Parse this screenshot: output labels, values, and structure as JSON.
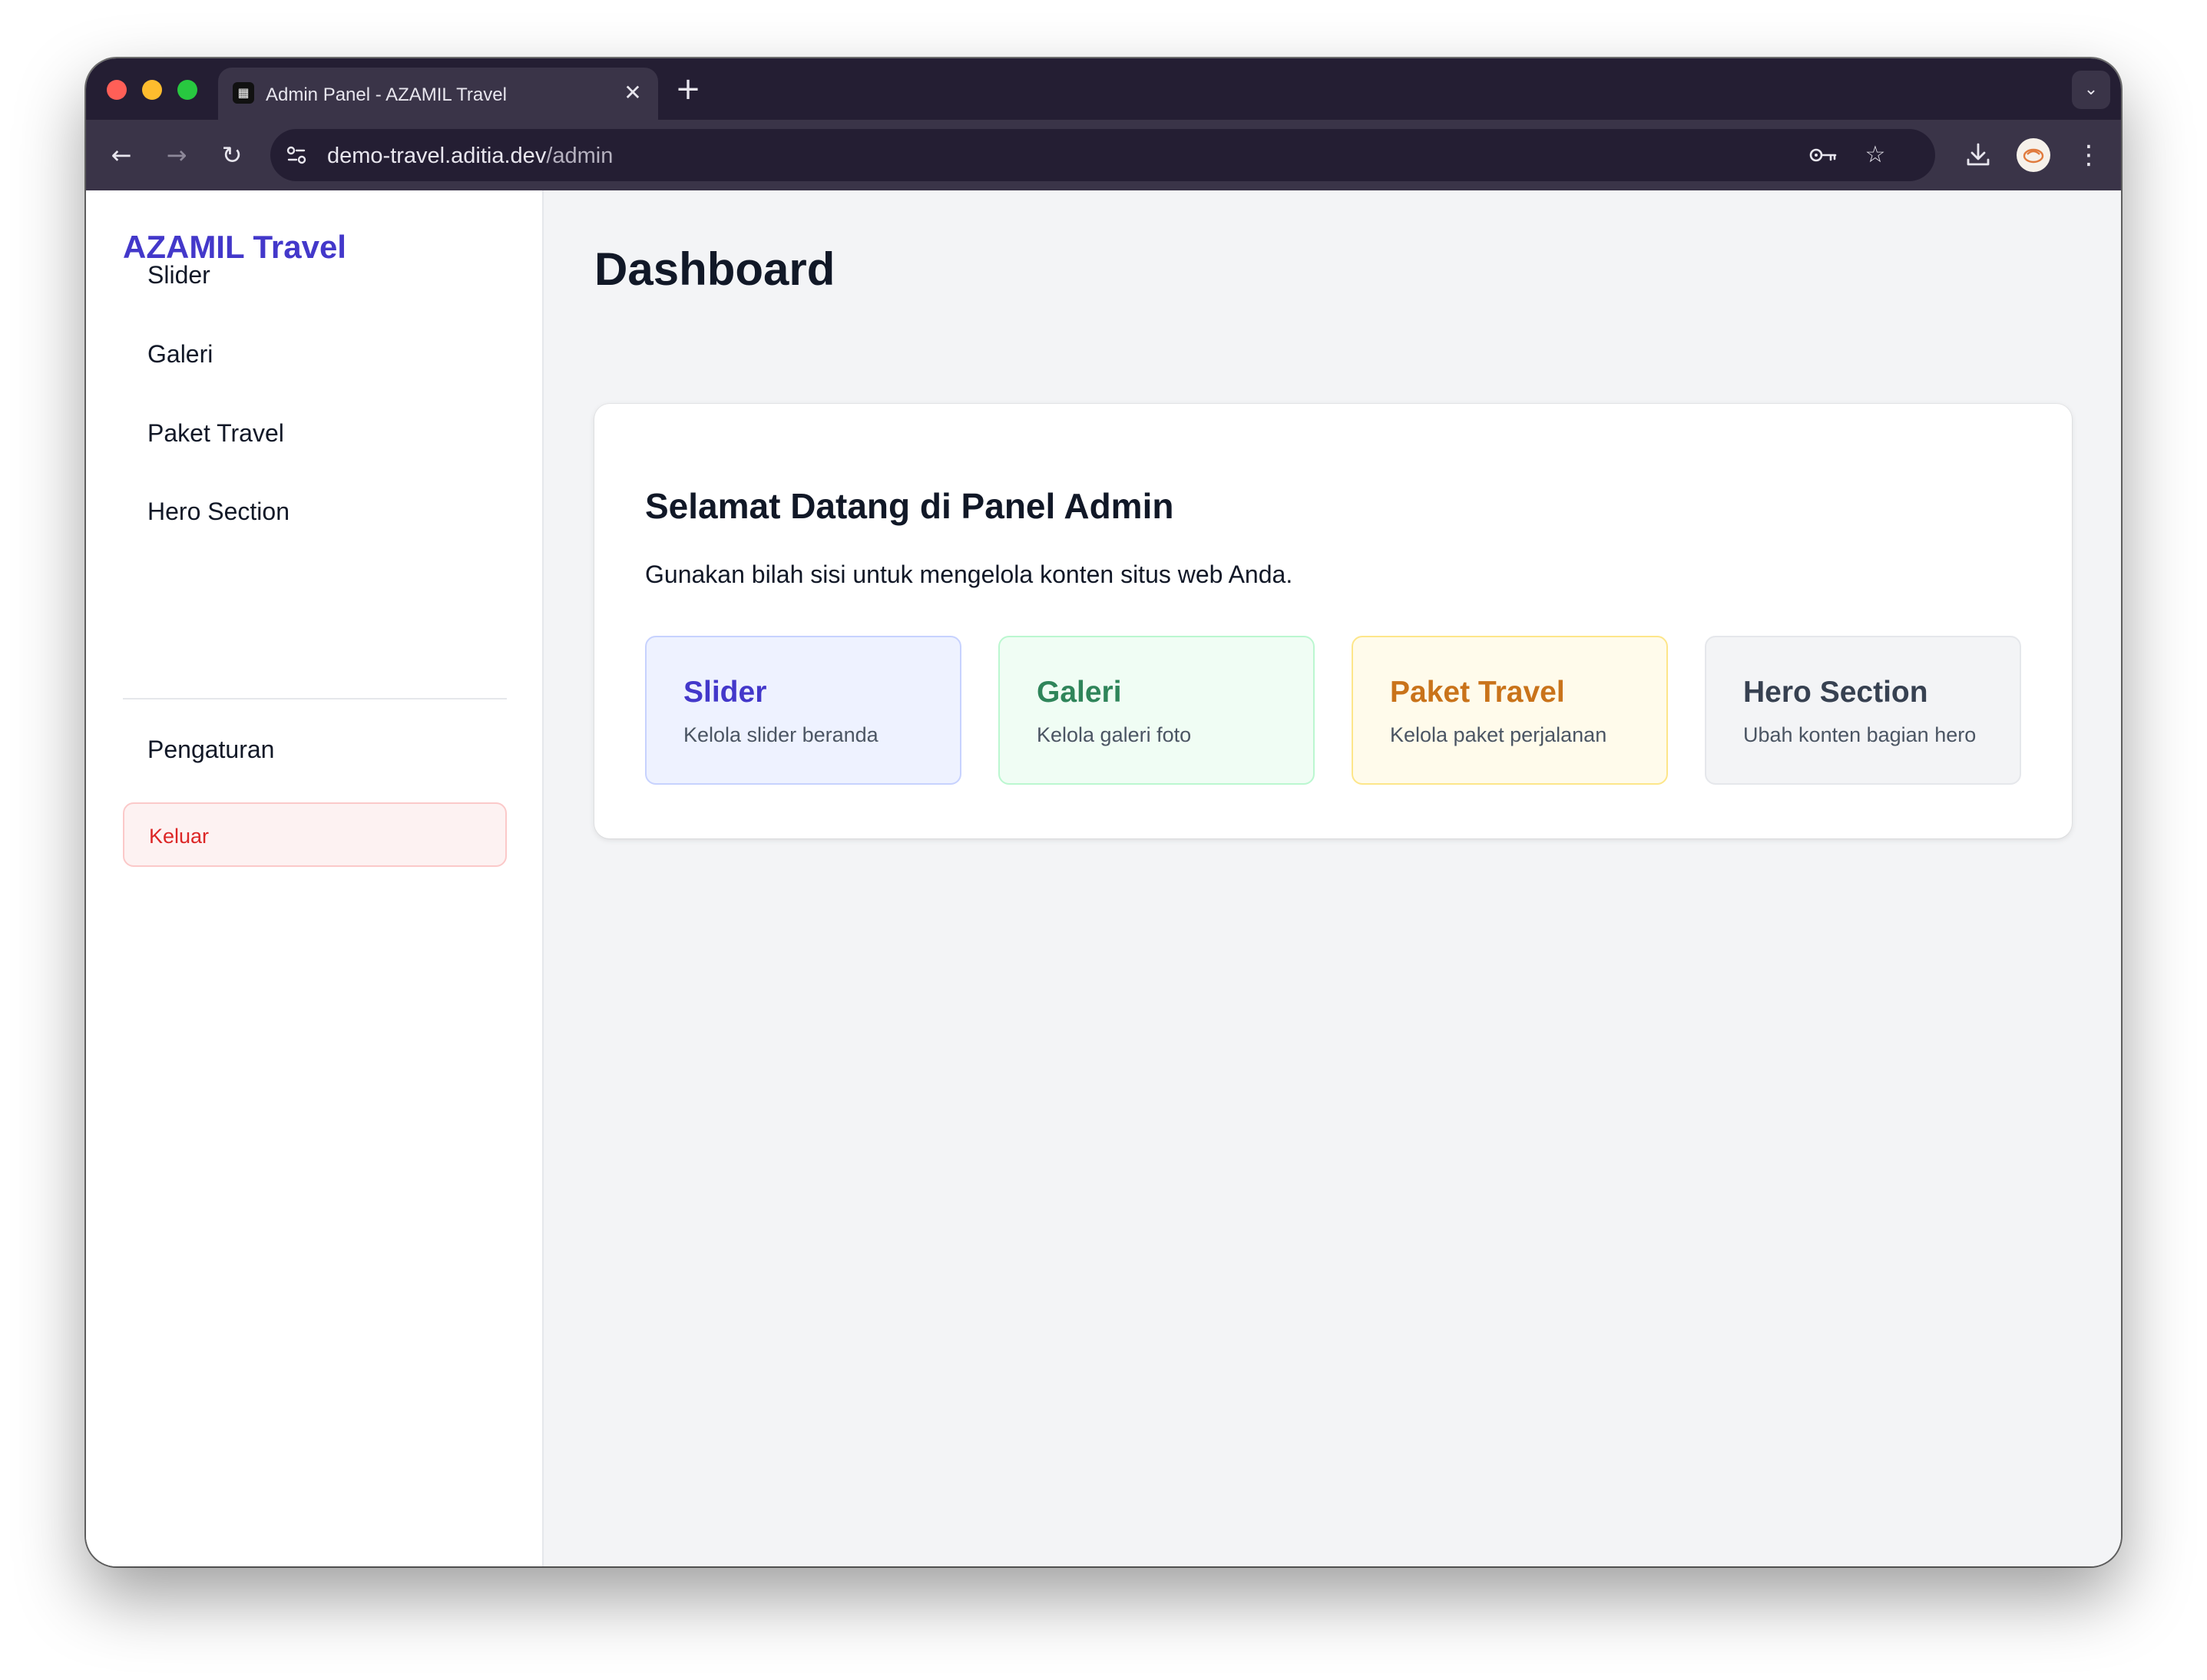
{
  "browser": {
    "tab_title": "Admin Panel - AZAMIL Travel",
    "url_host": "demo-travel.aditia.dev",
    "url_path": "/admin"
  },
  "icons": {
    "back": "arrow-left-icon",
    "forward": "arrow-right-icon",
    "reload": "reload-icon",
    "site_info": "tune-icon",
    "password": "key-icon",
    "bookmark": "star-icon",
    "download": "download-icon",
    "menu": "more-vertical-icon"
  },
  "sidebar": {
    "brand": "AZAMIL Travel",
    "items": [
      {
        "label": "Slider"
      },
      {
        "label": "Galeri"
      },
      {
        "label": "Paket Travel"
      },
      {
        "label": "Hero Section"
      }
    ],
    "settings_label": "Pengaturan",
    "logout_label": "Keluar"
  },
  "main": {
    "title": "Dashboard",
    "welcome_title": "Selamat Datang di Panel Admin",
    "welcome_text": "Gunakan bilah sisi untuk mengelola konten situs web Anda.",
    "cards": [
      {
        "title": "Slider",
        "desc": "Kelola slider beranda"
      },
      {
        "title": "Galeri",
        "desc": "Kelola galeri foto"
      },
      {
        "title": "Paket Travel",
        "desc": "Kelola paket perjalanan"
      },
      {
        "title": "Hero Section",
        "desc": "Ubah konten bagian hero"
      }
    ]
  },
  "colors": {
    "brand": "#4338ca",
    "slider_card_bg": "#eef2ff",
    "slider_card_border": "#c7d2fe",
    "slider_card_title": "#4338ca",
    "galeri_card_bg": "#f0fdf4",
    "galeri_card_border": "#bbf7d0",
    "galeri_card_title": "#2f855a",
    "paket_card_bg": "#fffbeb",
    "paket_card_border": "#fde68a",
    "paket_card_title": "#c9731a",
    "hero_card_bg": "#f3f4f6",
    "hero_card_border": "#e5e7eb",
    "hero_card_title": "#374151",
    "logout_text": "#dc2626"
  }
}
